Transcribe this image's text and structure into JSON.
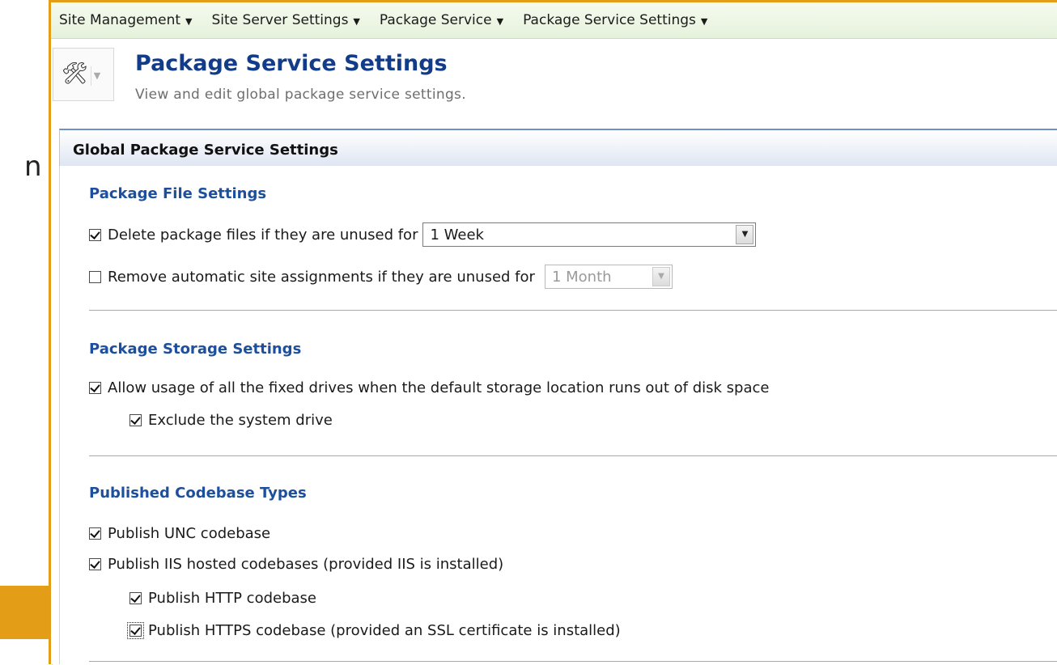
{
  "nav": {
    "items": [
      {
        "label": "Site Management"
      },
      {
        "label": "Site Server Settings"
      },
      {
        "label": "Package Service"
      },
      {
        "label": "Package Service Settings"
      }
    ]
  },
  "page": {
    "title": "Package Service Settings",
    "subtitle": "View and edit global package service settings.",
    "icon": "tools-icon"
  },
  "stray_text": "n",
  "section": {
    "title": "Global Package Service Settings"
  },
  "package_file_settings": {
    "title": "Package File Settings",
    "delete_files": {
      "checked": true,
      "label": "Delete package files if they are unused for",
      "value": "1 Week"
    },
    "remove_assignments": {
      "checked": false,
      "label": "Remove automatic site assignments if they are unused for",
      "value": "1 Month"
    }
  },
  "package_storage_settings": {
    "title": "Package Storage Settings",
    "allow_fixed_drives": {
      "checked": true,
      "label": "Allow usage of all the fixed drives when the default storage location runs out of disk space"
    },
    "exclude_system_drive": {
      "checked": true,
      "label": "Exclude the system drive"
    }
  },
  "published_codebase_types": {
    "title": "Published Codebase Types",
    "unc": {
      "checked": true,
      "label": "Publish UNC codebase"
    },
    "iis": {
      "checked": true,
      "label": "Publish IIS hosted codebases (provided IIS is installed)"
    },
    "http": {
      "checked": true,
      "label": "Publish HTTP codebase"
    },
    "https": {
      "checked": true,
      "label": "Publish HTTPS codebase (provided an SSL certificate is installed)"
    }
  },
  "colors": {
    "frame_border": "#e39d17",
    "arrow": "#e39d17",
    "title": "#123c8a",
    "group_title": "#1d4f9c"
  }
}
